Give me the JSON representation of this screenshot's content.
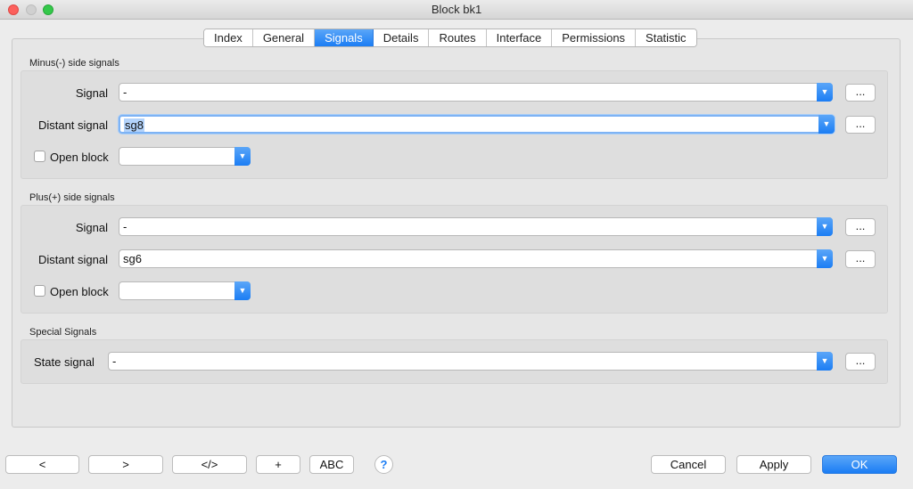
{
  "window": {
    "title": "Block bk1"
  },
  "tabs": [
    {
      "label": "Index"
    },
    {
      "label": "General"
    },
    {
      "label": "Signals",
      "active": true
    },
    {
      "label": "Details"
    },
    {
      "label": "Routes"
    },
    {
      "label": "Interface"
    },
    {
      "label": "Permissions"
    },
    {
      "label": "Statistic"
    }
  ],
  "minus": {
    "title": "Minus(-) side signals",
    "signal_label": "Signal",
    "signal_value": "-",
    "distant_label": "Distant signal",
    "distant_value": "sg8",
    "open_block_label": "Open block",
    "open_block_checked": false,
    "open_block_value": "",
    "browse": "..."
  },
  "plus": {
    "title": "Plus(+) side signals",
    "signal_label": "Signal",
    "signal_value": "-",
    "distant_label": "Distant signal",
    "distant_value": "sg6",
    "open_block_label": "Open block",
    "open_block_checked": false,
    "open_block_value": "",
    "browse": "..."
  },
  "special": {
    "title": "Special Signals",
    "state_label": "State signal",
    "state_value": "-",
    "browse": "..."
  },
  "bottom": {
    "prev": "<",
    "next": ">",
    "xml": "</>",
    "add": "+",
    "abc": "ABC",
    "help": "?",
    "cancel": "Cancel",
    "apply": "Apply",
    "ok": "OK"
  },
  "colors": {
    "accent": "#1b7df4",
    "close": "#fc605c",
    "zoom": "#34c84a"
  }
}
